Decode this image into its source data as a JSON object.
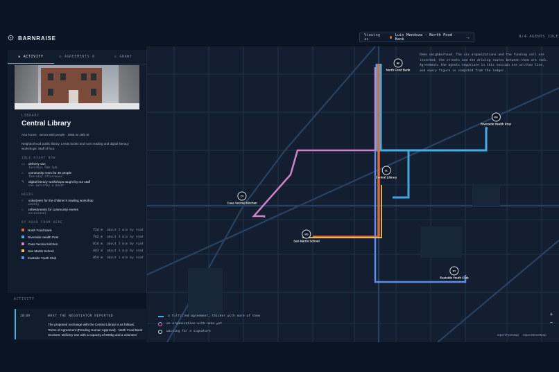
{
  "app": {
    "name": "BARNRAISE"
  },
  "header": {
    "viewing_label": "Viewing as",
    "viewing_value": "Luis Mendoza · North Food Bank",
    "agents_label": "AGENTS IDLE",
    "agents_prefix": "0/4"
  },
  "tabs": [
    {
      "label": "ACTIVITY",
      "active": true
    },
    {
      "label": "AGREEMENTS",
      "count": "0"
    },
    {
      "label": "GRANT"
    }
  ],
  "org": {
    "kicker": "LIBRARY",
    "title": "Central Library",
    "meta": "Ana Torres · serves 850 people · 1865 W 18th St",
    "description": "Neighborhood public library. Lends books and runs reading and digital literacy workshops. Staff of four.",
    "idle_heading": "IDLE RIGHT NOW",
    "idle": [
      {
        "icon": "van-icon",
        "label": "delivery van",
        "detail": "Tuesdays 9am-5pm"
      },
      {
        "icon": "room-icon",
        "label": "community room for 30 people",
        "detail": "Thursday afternoons"
      },
      {
        "icon": "workshop-icon",
        "label": "digital literacy workshops taught by our staff",
        "detail": "one Saturday a month"
      }
    ],
    "needs_heading": "NEEDS",
    "needs": [
      {
        "label": "volunteers for the children's reading workshop",
        "detail": "weekly"
      },
      {
        "label": "refreshments for community events",
        "detail": "occasional"
      }
    ],
    "road_heading": "BY ROAD FROM HERE",
    "roads": [
      {
        "name": "North Food Bank",
        "distance": "714 m",
        "time": "about 2 min by road",
        "color": "#e06a35"
      },
      {
        "name": "Riverside Health Post",
        "distance": "742 m",
        "time": "about 3 min by road",
        "color": "#3fb0e8"
      },
      {
        "name": "Casa Vecinal Kitchen",
        "distance": "814 m",
        "time": "about 3 min by road",
        "color": "#d283c4"
      },
      {
        "name": "San Martin School",
        "distance": "443 m",
        "time": "about 1 min by road",
        "color": "#f2c14e"
      },
      {
        "name": "Eastside Youth Club",
        "distance": "854 m",
        "time": "about 1 min by road",
        "color": "#5b8ef0"
      }
    ]
  },
  "activity": {
    "heading": "ACTIVITY",
    "time": "10:09",
    "title": "WHAT THE NEGOTIATOR REPORTED",
    "body": "The proposed exchange with the Central Library is as follows: Terms of Agreement (Pending Human Approval) · North Food Bank receives: Delivery Van with a capacity of 800kg and a volunteer"
  },
  "map": {
    "info": "Demo neighborhood. The six organizations and the funding call are invented; the streets and the driving routes between them are real. Agreements the agents negotiate in this session are written live, and every figure is computed from the ledger.",
    "markers": [
      {
        "code": "NF",
        "label": "North Food Bank"
      },
      {
        "code": "RH",
        "label": "Riverside Health Post"
      },
      {
        "code": "CL",
        "label": "Central Library"
      },
      {
        "code": "CV",
        "label": "Casa Vecinal Kitchen"
      },
      {
        "code": "MS",
        "label": "San Martin School"
      },
      {
        "code": "EY",
        "label": "Eastside Youth Club"
      }
    ],
    "legend": [
      "a fulfilled agreement, thicker with more of them",
      "an organization with none yet",
      "waiting for a signature"
    ],
    "attribution": [
      "OpenFreeMap",
      "OpenStreetMap"
    ],
    "zoom_in": "+",
    "zoom_out": "−"
  }
}
